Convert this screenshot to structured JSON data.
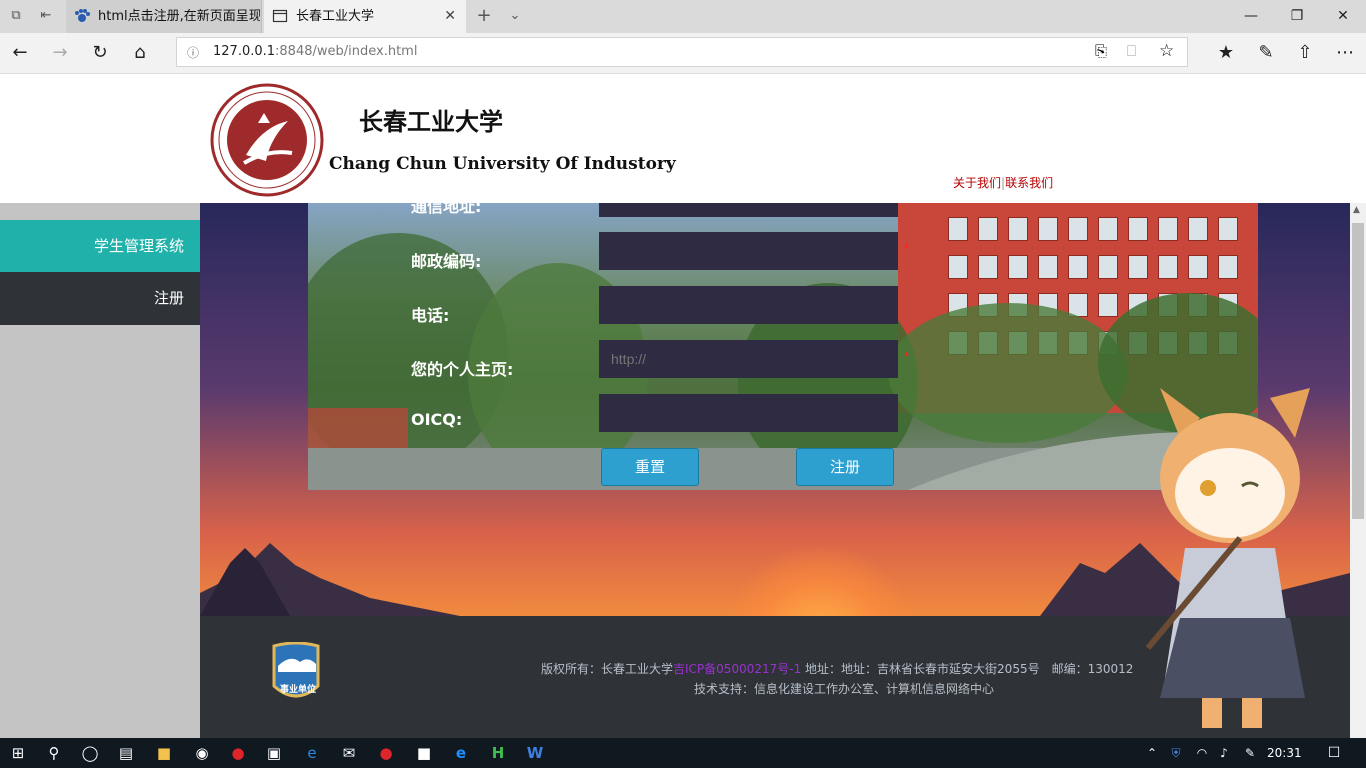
{
  "browser": {
    "tabs": [
      {
        "title": "html点击注册,在新页面呈现"
      },
      {
        "title": "长春工业大学"
      }
    ],
    "url_host": "127.0.0.1",
    "url_rest": ":8848/web/index.html"
  },
  "header": {
    "cn_name": "长春工业大学",
    "en_name": "Chang Chun University Of Industory",
    "links": {
      "about": "关于我们",
      "separator": "|",
      "contact": "联系我们"
    }
  },
  "sidebar": {
    "items": [
      {
        "label": "学生管理系统",
        "active": true
      },
      {
        "label": "注册",
        "active": false
      }
    ]
  },
  "form": {
    "fields": [
      {
        "label": "通信地址:",
        "value": "",
        "placeholder": ""
      },
      {
        "label": "邮政编码:",
        "value": "",
        "placeholder": ""
      },
      {
        "label": "电话:",
        "value": "",
        "placeholder": ""
      },
      {
        "label": "您的个人主页:",
        "value": "",
        "placeholder": "http://"
      },
      {
        "label": "OICQ:",
        "value": "",
        "placeholder": ""
      }
    ],
    "required_mark": "*",
    "reset_label": "重置",
    "submit_label": "注册"
  },
  "footer": {
    "badge_text": "事业单位",
    "line1_prefix": "版权所有：长春工业大学",
    "line1_link": "吉ICP备05000217号-1",
    "line1_suffix": "地址：地址：吉林省长春市延安大街2055号　邮编：130012",
    "line2": "技术支持：信息化建设工作办公室、计算机信息网络中心"
  },
  "taskbar": {
    "time": "20:31"
  },
  "colors": {
    "accent": "#20b2aa",
    "sidebar_dark": "#2f3338",
    "button": "#2ea0d0",
    "link_red": "#b20000"
  }
}
